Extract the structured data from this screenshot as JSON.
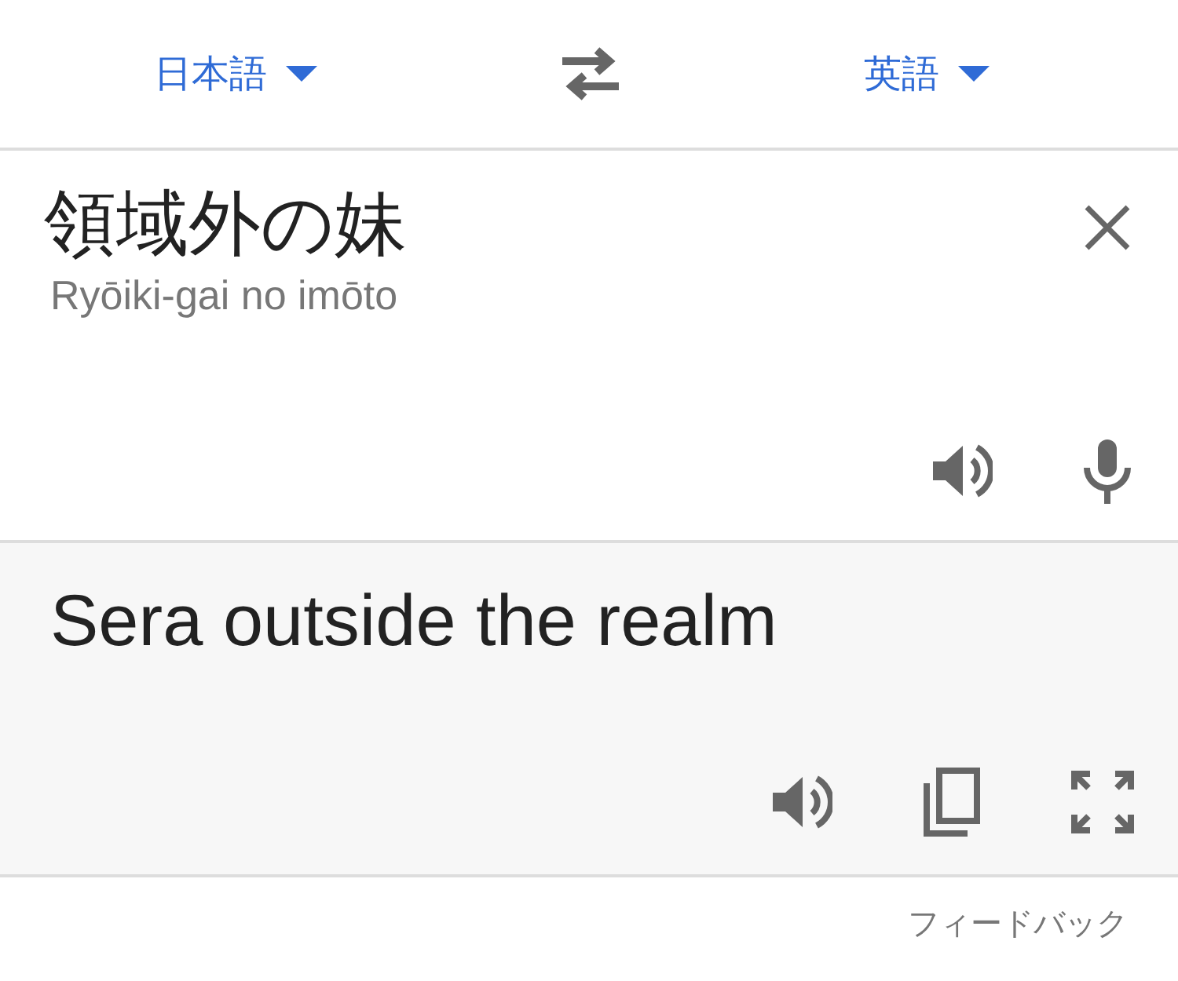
{
  "languages": {
    "source": "日本語",
    "target": "英語"
  },
  "input": {
    "text": "領域外の妹",
    "romanization": "Ryōiki-gai no imōto"
  },
  "output": {
    "text": "Sera outside the realm"
  },
  "feedback": "フィードバック"
}
